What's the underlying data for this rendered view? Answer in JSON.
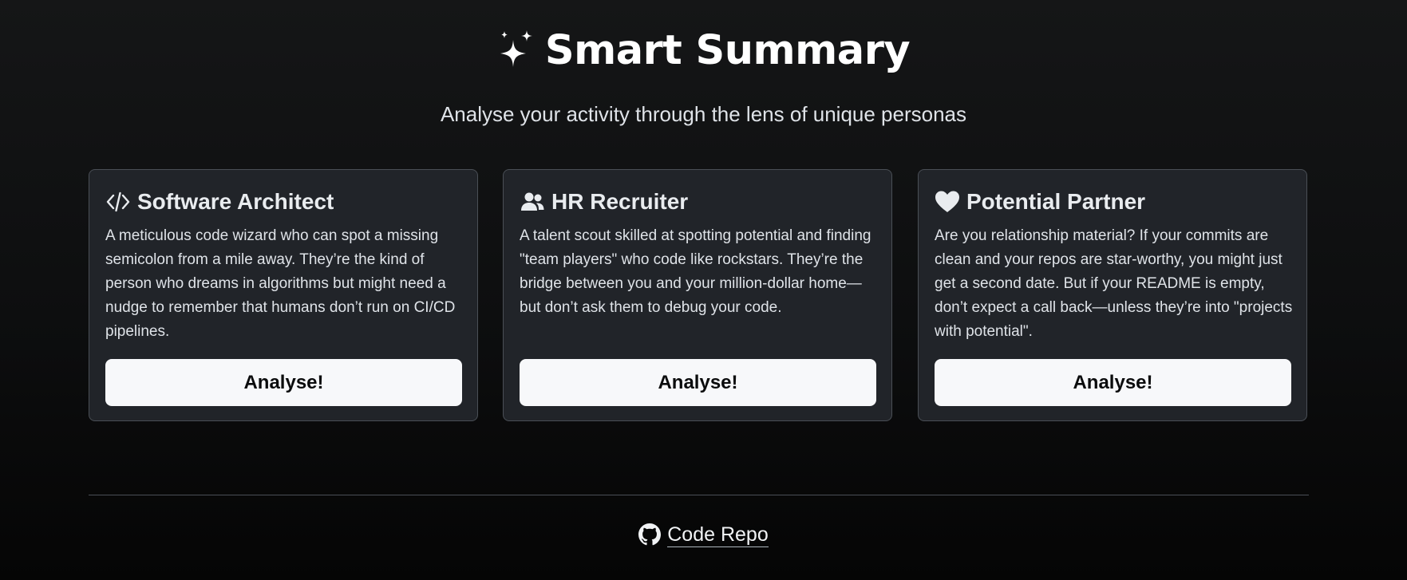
{
  "header": {
    "title": "Smart Summary",
    "subtitle": "Analyse your activity through the lens of unique personas",
    "icon": "sparkles-icon"
  },
  "personas": [
    {
      "icon": "code-icon",
      "title": "Software Architect",
      "description": "A meticulous code wizard who can spot a missing semicolon from a mile away. They’re the kind of person who dreams in algorithms but might need a nudge to remember that humans don’t run on CI/CD pipelines.",
      "button_label": "Analyse!"
    },
    {
      "icon": "people-icon",
      "title": "HR Recruiter",
      "description": "A talent scout skilled at spotting potential and finding \"team players\" who code like rockstars. They’re the bridge between you and your million-dollar home—but don’t ask them to debug your code.",
      "button_label": "Analyse!"
    },
    {
      "icon": "heart-icon",
      "title": "Potential Partner",
      "description": "Are you relationship material? If your commits are clean and your repos are star-worthy, you might just get a second date. But if your README is empty, don’t expect a call back—unless they’re into \"projects with potential\".",
      "button_label": "Analyse!"
    }
  ],
  "footer": {
    "icon": "github-icon",
    "link_label": "Code Repo"
  },
  "colors": {
    "background_top": "#151617",
    "background_bottom": "#050505",
    "card_background": "#212429",
    "card_border": "#4a4f56",
    "button_background": "#f7f8fa",
    "button_text": "#0b0c0d"
  }
}
